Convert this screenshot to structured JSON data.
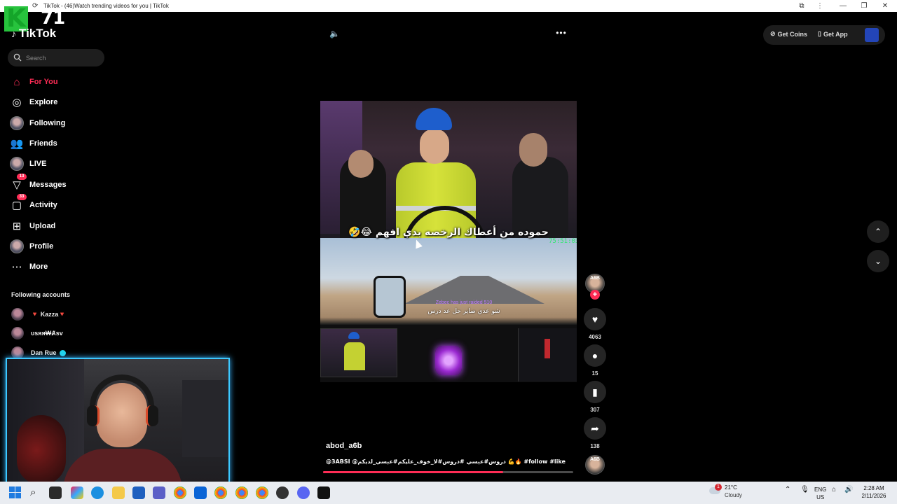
{
  "browser": {
    "tab_title": "TikTok - (46)Watch trending videos for you | TikTok",
    "minimize": "—",
    "restore": "❐",
    "close": "✕"
  },
  "overlay_logo": {
    "letter": "K",
    "number": "71"
  },
  "brand": {
    "logo_text": "TikTok"
  },
  "search": {
    "placeholder": "Search"
  },
  "nav": {
    "items": [
      {
        "label": "For You",
        "icon": "home-icon",
        "active": true
      },
      {
        "label": "Explore",
        "icon": "compass-icon"
      },
      {
        "label": "Following",
        "icon": "following-avatar"
      },
      {
        "label": "Friends",
        "icon": "friends-icon"
      },
      {
        "label": "LIVE",
        "icon": "live-icon"
      },
      {
        "label": "Messages",
        "icon": "messages-icon",
        "badge": "13"
      },
      {
        "label": "Activity",
        "icon": "activity-icon",
        "badge": "33"
      },
      {
        "label": "Upload",
        "icon": "upload-icon"
      },
      {
        "label": "Profile",
        "icon": "profile-avatar"
      },
      {
        "label": "More",
        "icon": "more-icon"
      }
    ]
  },
  "following_accounts": {
    "title": "Following accounts",
    "accounts": [
      {
        "name": "🔻 Kazza🔻"
      },
      {
        "name": "ᴜsᴙᴙ₩Ⱥsᴠ"
      },
      {
        "name": "Dan Rue",
        "verified": true
      }
    ]
  },
  "header": {
    "get_coins": "Get Coins",
    "get_app": "Get App"
  },
  "video": {
    "caption": "حموده من أعطاك الرخصه بدي افهم 😂🤣",
    "timer": "75:51:03",
    "sub_line1": "Zebec has just raided 510",
    "sub_line2": "شو عدي صاير حل عد درس",
    "author": "abod_a6b",
    "description": "@3ABSI @دروس#عبسي #دروس#لا_خوف_عليكم#عبسي_لديكم 💪🔥 #follow #like",
    "progress": 0.72
  },
  "actions": {
    "creator_tag": "A6B",
    "likes": "4063",
    "comments": "15",
    "saves": "307",
    "shares": "138"
  },
  "taskbar": {
    "weather_temp": "21°C",
    "weather_cond": "Cloudy",
    "weather_badge": "1",
    "lang_top": "ENG",
    "lang_bottom": "US",
    "time": "2:28 AM",
    "date": "2/11/2026"
  },
  "colors": {
    "accent": "#fe2c55",
    "webcam_border": "#3cc8ff",
    "timer": "#2ee86c"
  }
}
